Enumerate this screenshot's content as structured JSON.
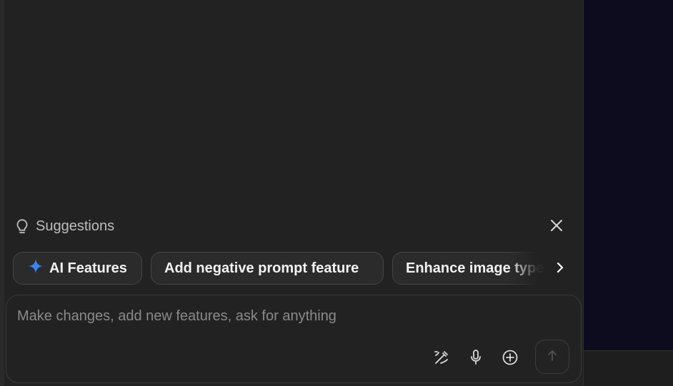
{
  "suggestions": {
    "header_label": "Suggestions",
    "header_icon": "lightbulb-icon",
    "close_icon": "close-icon",
    "chips": [
      {
        "label": "AI Features",
        "icon": "sparkle-icon",
        "icon_color": "#3b82f6"
      },
      {
        "label": "Add negative prompt feature"
      },
      {
        "label": "Enhance image type"
      }
    ],
    "scroll_icon": "chevron-right-icon"
  },
  "composer": {
    "placeholder": "Make changes, add new features, ask for anything",
    "value": "",
    "tools": [
      "magic-edit-icon",
      "microphone-icon",
      "plus-circle-icon"
    ],
    "send_icon": "arrow-up-icon"
  },
  "colors": {
    "panel_bg": "#222222",
    "preview_bg": "#0d0b1e",
    "accent": "#3b82f6"
  }
}
